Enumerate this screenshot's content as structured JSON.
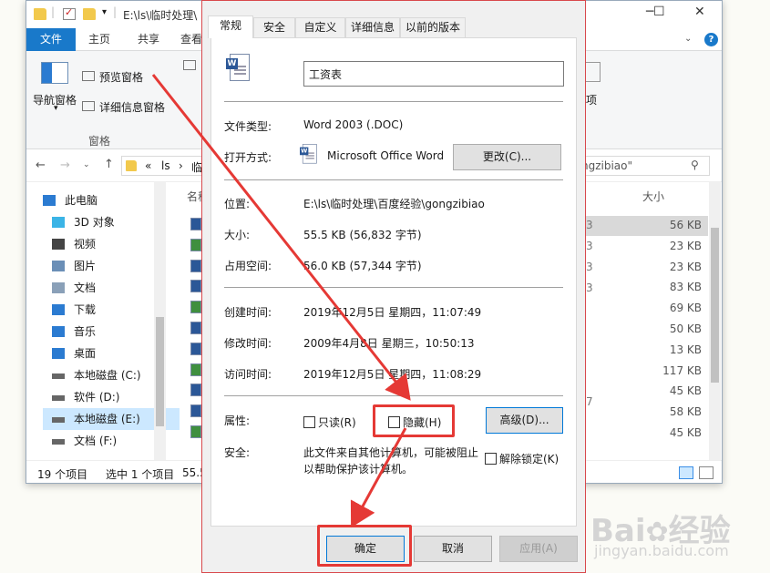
{
  "explorer": {
    "title_path": "E:\\ls\\临时处理\\",
    "ribbon_tabs": [
      "文件",
      "主页",
      "共享",
      "查看"
    ],
    "ribbon": {
      "nav_pane_label": "导航窗格",
      "preview_pane_label": "预览窗格",
      "details_pane_label": "详细信息窗格",
      "group_label": "窗格",
      "right_label": "项"
    },
    "address": {
      "crumbs": [
        "«",
        "ls",
        "临"
      ],
      "search_text": "ngzibiao\""
    },
    "columns": {
      "name": "名称",
      "size": "大小"
    },
    "sizes": [
      "56 KB",
      "23 KB",
      "23 KB",
      "83 KB",
      "69 KB",
      "50 KB",
      "13 KB",
      "117 KB",
      "45 KB",
      "58 KB",
      "45 KB"
    ],
    "partial_dates": [
      "3",
      "3",
      "3",
      "3",
      "7"
    ],
    "nav_items": [
      {
        "label": "此电脑",
        "icon": "pc-icon"
      },
      {
        "label": "3D 对象",
        "icon": "cube-icon"
      },
      {
        "label": "视频",
        "icon": "video-icon"
      },
      {
        "label": "图片",
        "icon": "picture-icon"
      },
      {
        "label": "文档",
        "icon": "document-icon"
      },
      {
        "label": "下载",
        "icon": "download-icon"
      },
      {
        "label": "音乐",
        "icon": "music-icon"
      },
      {
        "label": "桌面",
        "icon": "desktop-icon"
      },
      {
        "label": "本地磁盘 (C:)",
        "icon": "drive-icon"
      },
      {
        "label": "软件 (D:)",
        "icon": "drive-icon"
      },
      {
        "label": "本地磁盘 (E:)",
        "icon": "drive-icon"
      },
      {
        "label": "文档 (F:)",
        "icon": "drive-icon"
      }
    ],
    "status": {
      "count": "19 个项目",
      "selected": "选中 1 个项目",
      "size_frag": "55.5"
    },
    "window_buttons": [
      "─",
      "☐",
      "✕"
    ]
  },
  "dialog": {
    "tabs": [
      "常规",
      "安全",
      "自定义",
      "详细信息",
      "以前的版本"
    ],
    "filename": "工资表",
    "rows": {
      "type_label": "文件类型:",
      "type_value": "Word 2003 (.DOC)",
      "open_label": "打开方式:",
      "open_value": "Microsoft Office Word",
      "change_button": "更改(C)...",
      "location_label": "位置:",
      "location_value": "E:\\ls\\临时处理\\百度经验\\gongzibiao",
      "size_label": "大小:",
      "size_value": "55.5 KB (56,832 字节)",
      "disk_label": "占用空间:",
      "disk_value": "56.0 KB (57,344 字节)",
      "created_label": "创建时间:",
      "created_value": "2019年12月5日 星期四，11:07:49",
      "modified_label": "修改时间:",
      "modified_value": "2009年4月8日 星期三，10:50:13",
      "accessed_label": "访问时间:",
      "accessed_value": "2019年12月5日 星期四，11:08:29",
      "attr_label": "属性:",
      "readonly_label": "只读(R)",
      "hidden_label": "隐藏(H)",
      "advanced_button": "高级(D)...",
      "security_label": "安全:",
      "security_text_1": "此文件来自其他计算机，可能被阻止",
      "security_text_2": "以帮助保护该计算机。",
      "unblock_label": "解除锁定(K)"
    },
    "ok": "确定",
    "cancel": "取消",
    "apply": "应用(A)"
  },
  "watermark": {
    "brand": "Bai",
    "brand2": "经验",
    "url": "jingyan.baidu.com"
  },
  "colors": {
    "accent": "#1979ca",
    "highlight": "#e53935",
    "selection": "#cce8ff"
  }
}
